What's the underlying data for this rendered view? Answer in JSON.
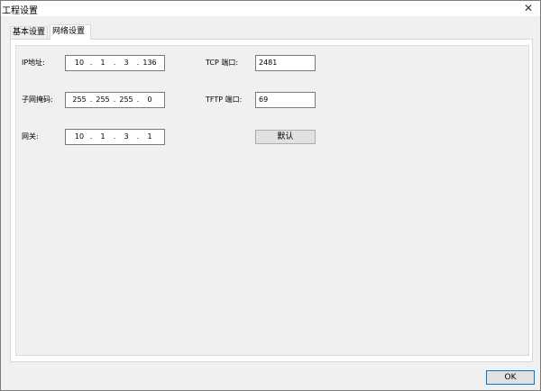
{
  "window": {
    "title": "工程设置",
    "close_icon": "close-icon"
  },
  "tabs": [
    {
      "label": "基本设置",
      "active": false
    },
    {
      "label": "网络设置",
      "active": true
    }
  ],
  "network": {
    "ip": {
      "label": "IP地址:",
      "octets": [
        "10",
        "1",
        "3",
        "136"
      ]
    },
    "mask": {
      "label": "子网掩码:",
      "octets": [
        "255",
        "255",
        "255",
        "0"
      ]
    },
    "gateway": {
      "label": "网关:",
      "octets": [
        "10",
        "1",
        "3",
        "1"
      ]
    },
    "tcp_port": {
      "label": "TCP 端口:",
      "value": "2481"
    },
    "tftp_port": {
      "label": "TFTP 端口:",
      "value": "69"
    },
    "default_button": "默认"
  },
  "footer": {
    "ok_button": "OK"
  }
}
